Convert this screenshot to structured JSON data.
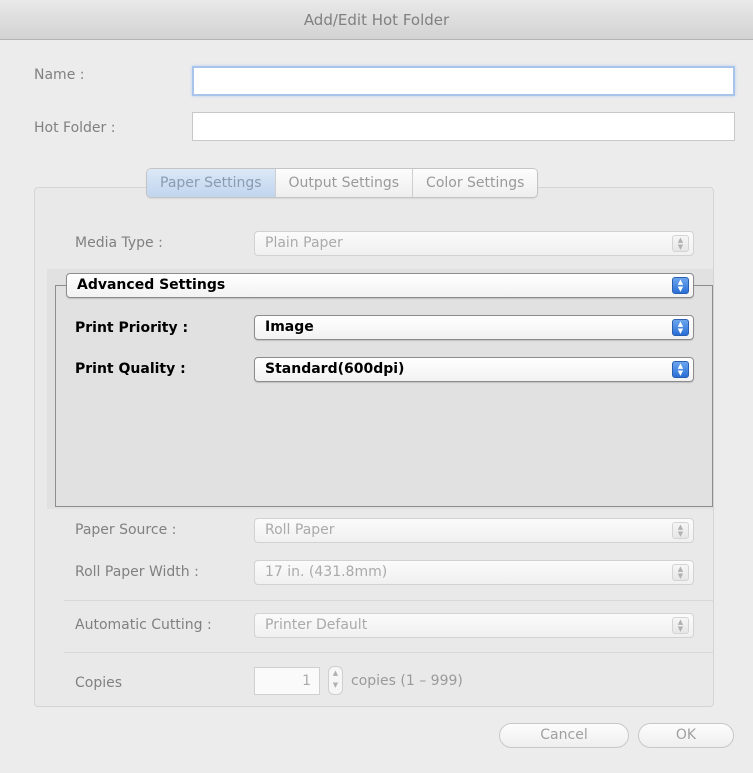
{
  "window": {
    "title": "Add/Edit Hot Folder"
  },
  "name_field": {
    "label": "Name :",
    "value": ""
  },
  "hotfolder_field": {
    "label": "Hot Folder :",
    "value": ""
  },
  "tabs": [
    {
      "label": "Paper Settings",
      "active": true
    },
    {
      "label": "Output Settings",
      "active": false
    },
    {
      "label": "Color Settings",
      "active": false
    }
  ],
  "media_type": {
    "label": "Media Type :",
    "value": "Plain Paper"
  },
  "advanced": {
    "selector": "Advanced Settings",
    "print_priority": {
      "label": "Print Priority :",
      "value": "Image"
    },
    "print_quality": {
      "label": "Print Quality :",
      "value": "Standard(600dpi)"
    }
  },
  "paper_source": {
    "label": "Paper Source :",
    "value": "Roll Paper"
  },
  "roll_width": {
    "label": "Roll Paper Width :",
    "value": "17 in. (431.8mm)"
  },
  "auto_cut": {
    "label": "Automatic Cutting :",
    "value": "Printer Default"
  },
  "copies": {
    "label": "Copies",
    "value": "1",
    "suffix": "copies (1 – 999)"
  },
  "buttons": {
    "cancel": "Cancel",
    "ok": "OK"
  },
  "colors": {
    "accent": "#2a6fd6",
    "disabled_text": "#aaaaaa"
  }
}
